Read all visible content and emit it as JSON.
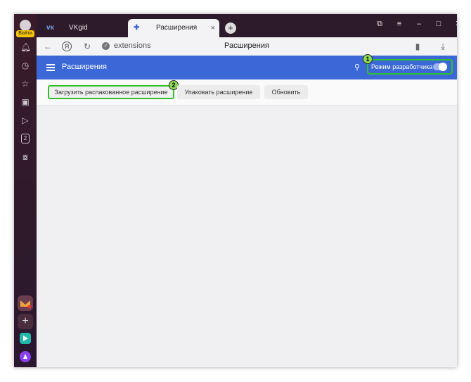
{
  "sidebar": {
    "login_label": "Войти",
    "icons": [
      "bell-icon",
      "clock-icon",
      "star-icon",
      "collections-icon",
      "play-icon",
      "counter-icon",
      "screenshot-icon"
    ],
    "counter_value": "2"
  },
  "tabs": [
    {
      "label": "VKgid",
      "icon": "vk-icon",
      "active": false
    },
    {
      "label": "Расширения",
      "icon": "puzzle-icon",
      "active": true,
      "close": "×"
    }
  ],
  "new_tab": "+",
  "window_controls": [
    "⧉",
    "≡",
    "–",
    "□",
    "✕"
  ],
  "address": {
    "ya_label": "Я",
    "url": "extensions",
    "page_title": "Расширения"
  },
  "header": {
    "title": "Расширения",
    "dev_mode_label": "Режим разработчика",
    "dev_mode_on": true
  },
  "actions": {
    "load_unpacked": "Загрузить распакованное расширение",
    "pack": "Упаковать расширение",
    "update": "Обновить"
  },
  "badges": {
    "one": "1",
    "two": "2"
  },
  "colors": {
    "header_blue": "#3b68d6",
    "highlight_green": "#2fbf2f",
    "sidebar_bg": "#2e1a2a"
  }
}
